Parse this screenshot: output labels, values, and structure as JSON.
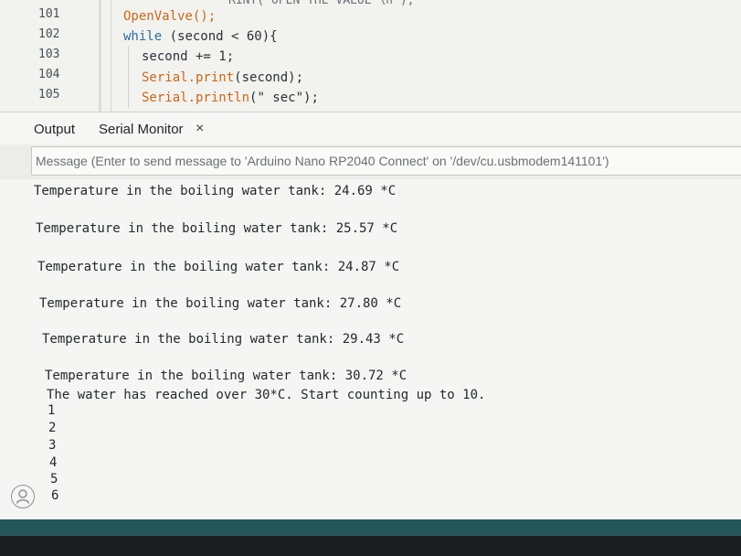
{
  "editor": {
    "truncated_line": "RINT(\"OPEN THE VALUE \\n\");",
    "lines": [
      {
        "num": "101",
        "text": "OpenValve();"
      },
      {
        "num": "102",
        "kw": "while",
        "rest": " (second < 60){"
      },
      {
        "num": "103",
        "text": "second += 1;"
      },
      {
        "num": "104",
        "fn": "Serial.print",
        "rest": "(second);"
      },
      {
        "num": "105",
        "fn": "Serial.println",
        "rest": "(\" sec\");"
      }
    ]
  },
  "tabs": {
    "output": "Output",
    "serial_monitor": "Serial Monitor",
    "close_glyph": "×"
  },
  "message": {
    "placeholder": "Message (Enter to send message to 'Arduino Nano RP2040 Connect' on '/dev/cu.usbmodem141101')"
  },
  "serial_output": [
    "Temperature in the boiling water tank: 24.69 *C",
    "Temperature in the boiling water tank: 25.57 *C",
    "Temperature in the boiling water tank: 24.87 *C",
    "Temperature in the boiling water tank: 27.80 *C",
    "Temperature in the boiling water tank: 29.43 *C",
    "Temperature in the boiling water tank: 30.72 *C",
    "The water has reached over 30*C. Start counting up to 10.",
    "1",
    "2",
    "3",
    "4",
    "5",
    "6"
  ],
  "colors": {
    "status_bar": "#24575a",
    "keyword": "#2e6c9c",
    "function": "#c9681a"
  },
  "icons": {
    "account": "account-icon"
  }
}
